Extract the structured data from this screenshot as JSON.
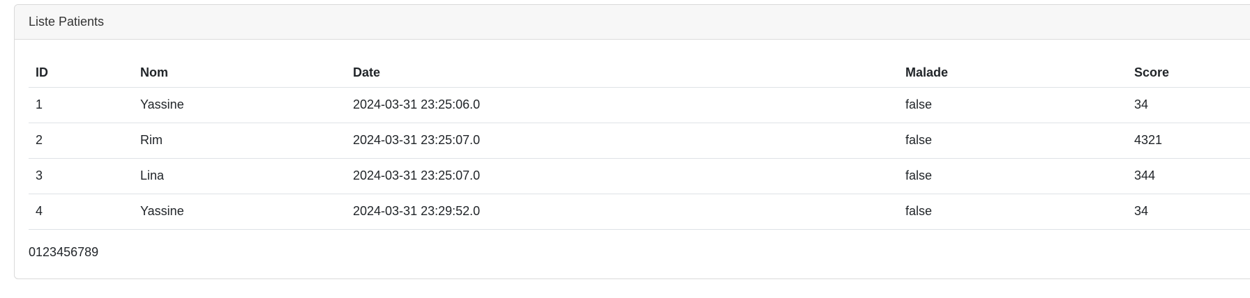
{
  "card": {
    "title": "Liste Patients"
  },
  "table": {
    "columns": [
      "ID",
      "Nom",
      "Date",
      "Malade",
      "Score"
    ],
    "rows": [
      {
        "id": "1",
        "nom": "Yassine",
        "date": "2024-03-31 23:25:06.0",
        "malade": "false",
        "score": "34"
      },
      {
        "id": "2",
        "nom": "Rim",
        "date": "2024-03-31 23:25:07.0",
        "malade": "false",
        "score": "4321"
      },
      {
        "id": "3",
        "nom": "Lina",
        "date": "2024-03-31 23:25:07.0",
        "malade": "false",
        "score": "344"
      },
      {
        "id": "4",
        "nom": "Yassine",
        "date": "2024-03-31 23:29:52.0",
        "malade": "false",
        "score": "34"
      }
    ]
  },
  "pagination": {
    "pages": [
      "0",
      "1",
      "2",
      "3",
      "4",
      "5",
      "6",
      "7",
      "8",
      "9"
    ]
  }
}
